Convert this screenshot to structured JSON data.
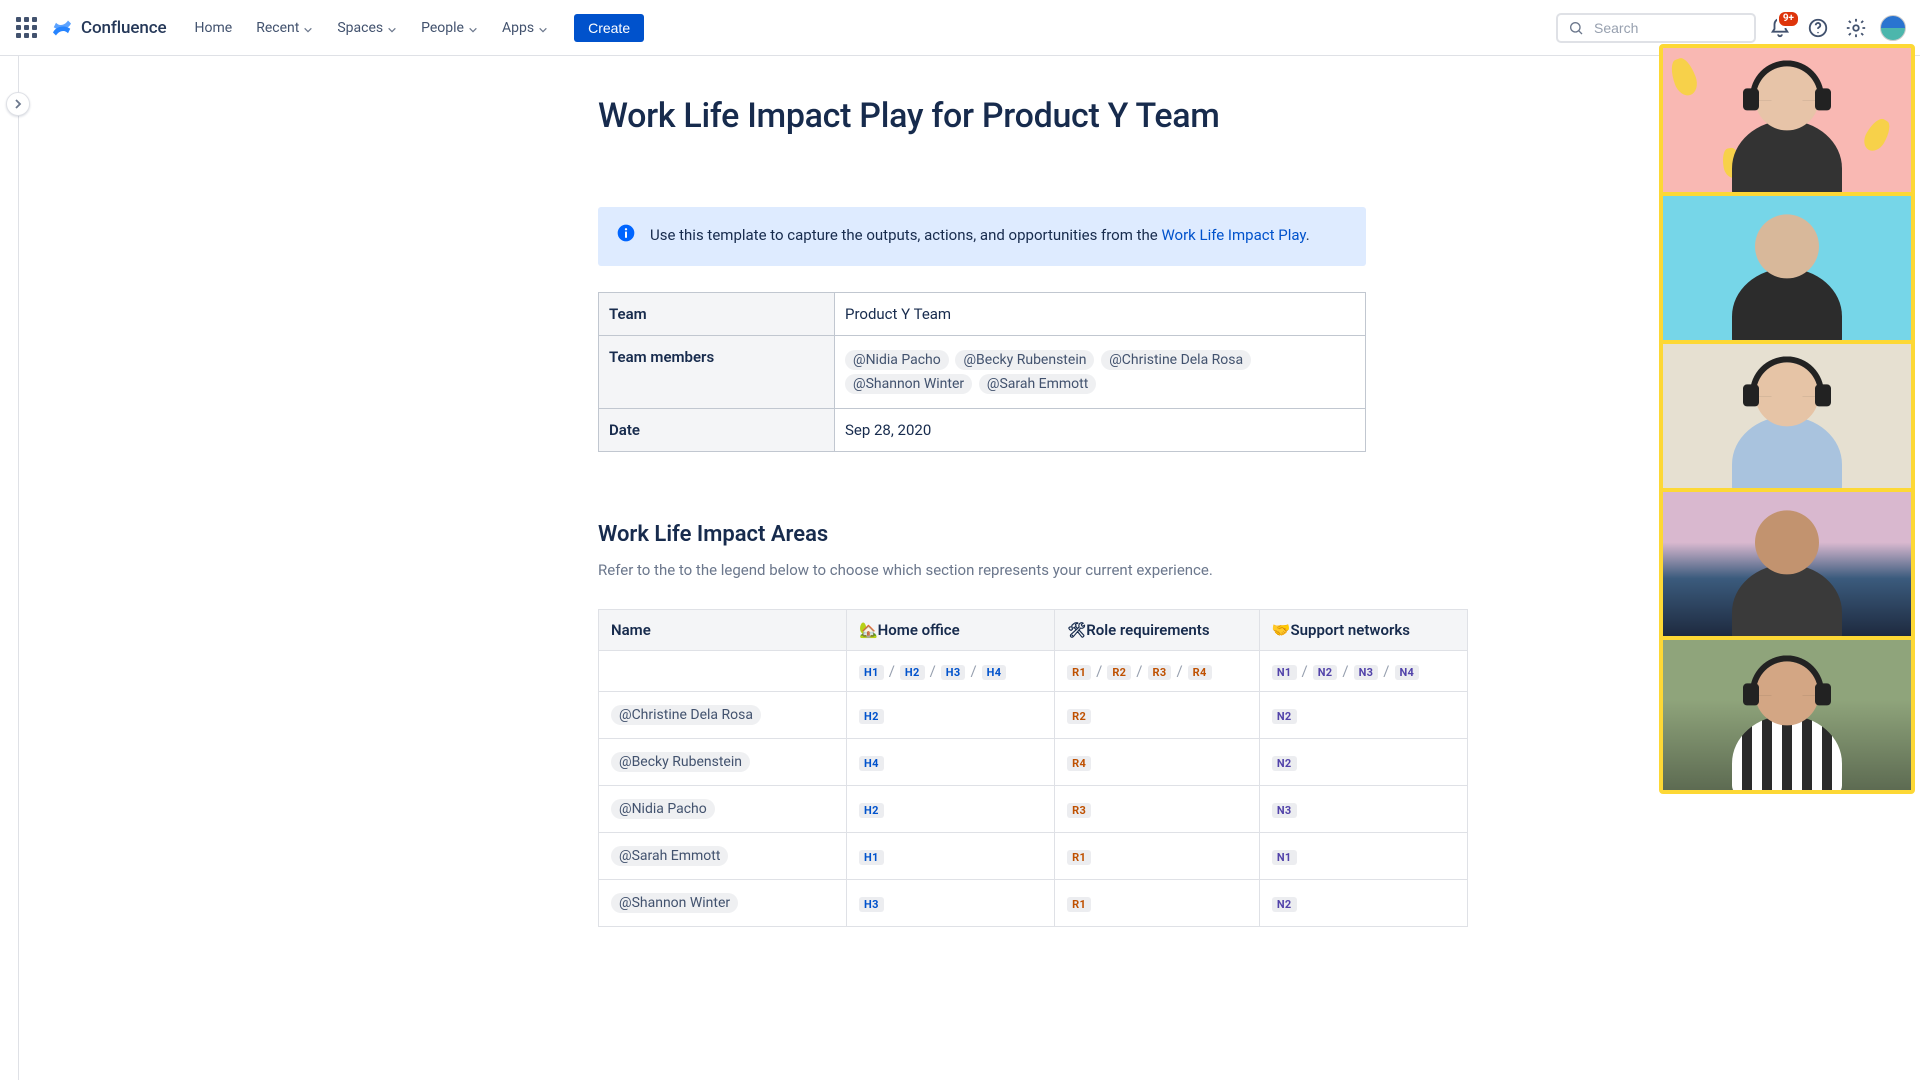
{
  "nav": {
    "product": "Confluence",
    "home": "Home",
    "recent": "Recent",
    "spaces": "Spaces",
    "people": "People",
    "apps": "Apps",
    "create": "Create",
    "searchPlaceholder": "Search",
    "notifBadge": "9+"
  },
  "page": {
    "title": "Work Life Impact Play for Product Y Team"
  },
  "infoPanel": {
    "preText": "Use this template to capture the outputs, actions, and opportunities from the ",
    "linkText": "Work Life Impact Play",
    "postText": "."
  },
  "meta": {
    "labels": {
      "team": "Team",
      "members": "Team members",
      "date": "Date"
    },
    "team": "Product Y Team",
    "members": [
      "@Nidia Pacho",
      "@Becky Rubenstein",
      "@Christine Dela Rosa",
      "@Shannon Winter",
      "@Sarah Emmott"
    ],
    "date": "Sep 28, 2020"
  },
  "impact": {
    "heading": "Work Life Impact Areas",
    "subheading": "Refer to the to the legend below to choose which section represents your current experience.",
    "columns": {
      "name": "Name",
      "home": "🏡Home office",
      "role": "🛠Role requirements",
      "support": "🤝Support networks"
    },
    "legend": {
      "home": [
        "H1",
        "H2",
        "H3",
        "H4"
      ],
      "role": [
        "R1",
        "R2",
        "R3",
        "R4"
      ],
      "support": [
        "N1",
        "N2",
        "N3",
        "N4"
      ]
    },
    "rows": [
      {
        "name": "@Christine Dela Rosa",
        "home": "H2",
        "role": "R2",
        "support": "N2"
      },
      {
        "name": "@Becky Rubenstein",
        "home": "H4",
        "role": "R4",
        "support": "N2"
      },
      {
        "name": "@Nidia Pacho",
        "home": "H2",
        "role": "R3",
        "support": "N3"
      },
      {
        "name": "@Sarah Emmott",
        "home": "H1",
        "role": "R1",
        "support": "N1"
      },
      {
        "name": "@Shannon Winter",
        "home": "H3",
        "role": "R1",
        "support": "N2"
      }
    ]
  },
  "video": {
    "participantCount": 5
  }
}
